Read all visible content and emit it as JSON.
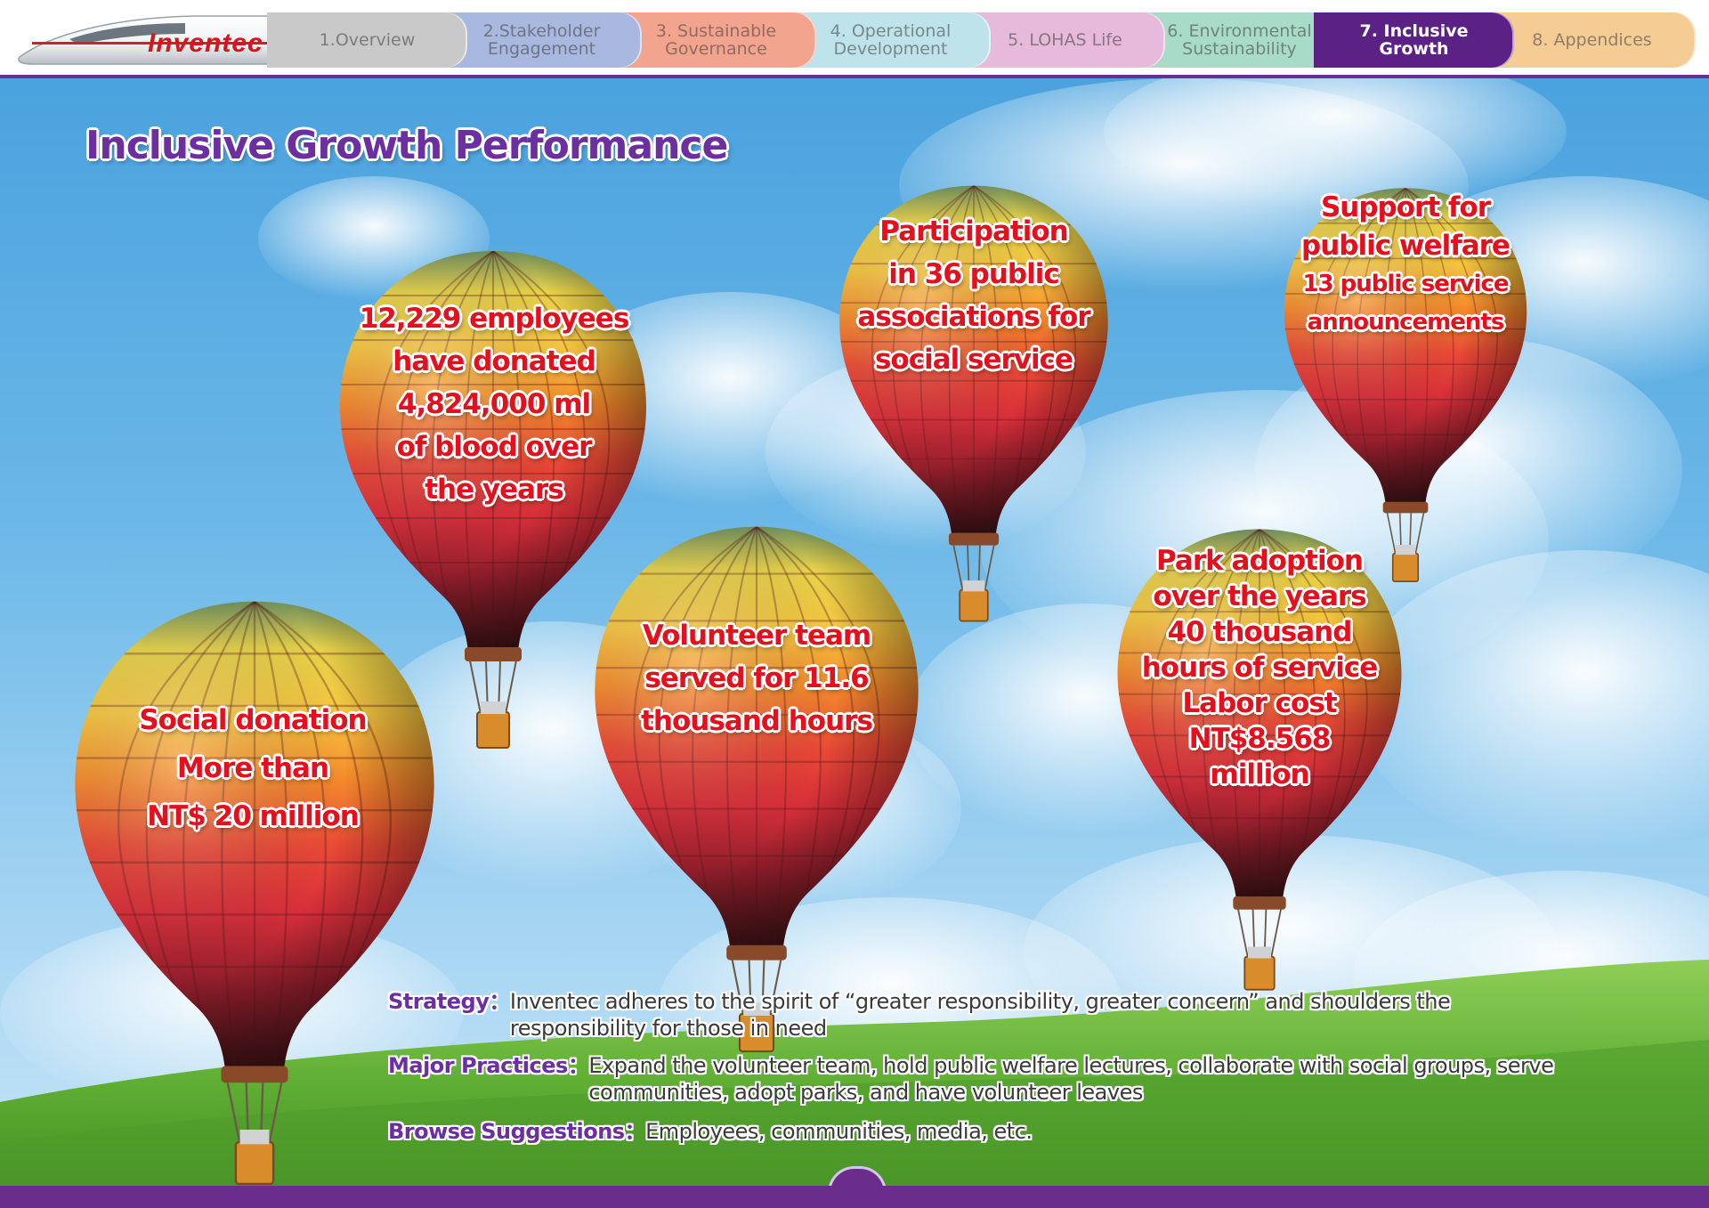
{
  "brand": {
    "logo_text": "Inventec"
  },
  "nav": {
    "tabs": [
      {
        "line1": "1.Overview",
        "line2": "",
        "color": "#c9c9c9"
      },
      {
        "line1": "2.Stakeholder",
        "line2": "Engagement",
        "color": "#a9b8de"
      },
      {
        "line1": "3. Sustainable",
        "line2": "Governance",
        "color": "#f2a48e"
      },
      {
        "line1": "4. Operational",
        "line2": "Development",
        "color": "#bfe3ea"
      },
      {
        "line1": "5. LOHAS Life",
        "line2": "",
        "color": "#e7b9da"
      },
      {
        "line1": "6. Environmental",
        "line2": "Sustainability",
        "color": "#a8dcc9"
      },
      {
        "line1": "7. Inclusive",
        "line2": "Growth",
        "color": "#5b2184"
      },
      {
        "line1": "8. Appendices",
        "line2": "",
        "color": "#f6cc95"
      }
    ],
    "active_index": 6
  },
  "page": {
    "title": "Inclusive Growth Performance"
  },
  "balloons": {
    "blood": [
      "12,229 employees",
      "have donated",
      "4,824,000 ml",
      "of blood over",
      "the years"
    ],
    "associations": [
      "Participation",
      "in 36 public",
      "associations for",
      "social service"
    ],
    "welfare": [
      "Support for",
      "public welfare",
      "13 public service",
      "announcements"
    ],
    "volunteer": [
      "Volunteer team",
      "served for 11.6",
      "thousand hours"
    ],
    "park": [
      "Park adoption",
      "over the years",
      "40 thousand",
      "hours of service",
      "Labor cost",
      "NT$8.568",
      "million"
    ],
    "donation": [
      "Social donation",
      "More than",
      "NT$ 20 million"
    ]
  },
  "info": {
    "strategy_label": "Strategy：",
    "strategy_text": "Inventec adheres to the spirit of “greater responsibility, greater concern” and shoulders the responsibility for those in need",
    "practices_label": "Major Practices：",
    "practices_text": "Expand the volunteer team, hold public welfare lectures, collaborate with social groups, serve communities, adopt parks, and have volunteer leaves",
    "browse_label": "Browse Suggestions：",
    "browse_text": "Employees, communities, media, etc."
  },
  "colors": {
    "accent_purple": "#6b2fa0",
    "brand_red": "#e4101e",
    "nav_rule": "#6a2d8b"
  }
}
